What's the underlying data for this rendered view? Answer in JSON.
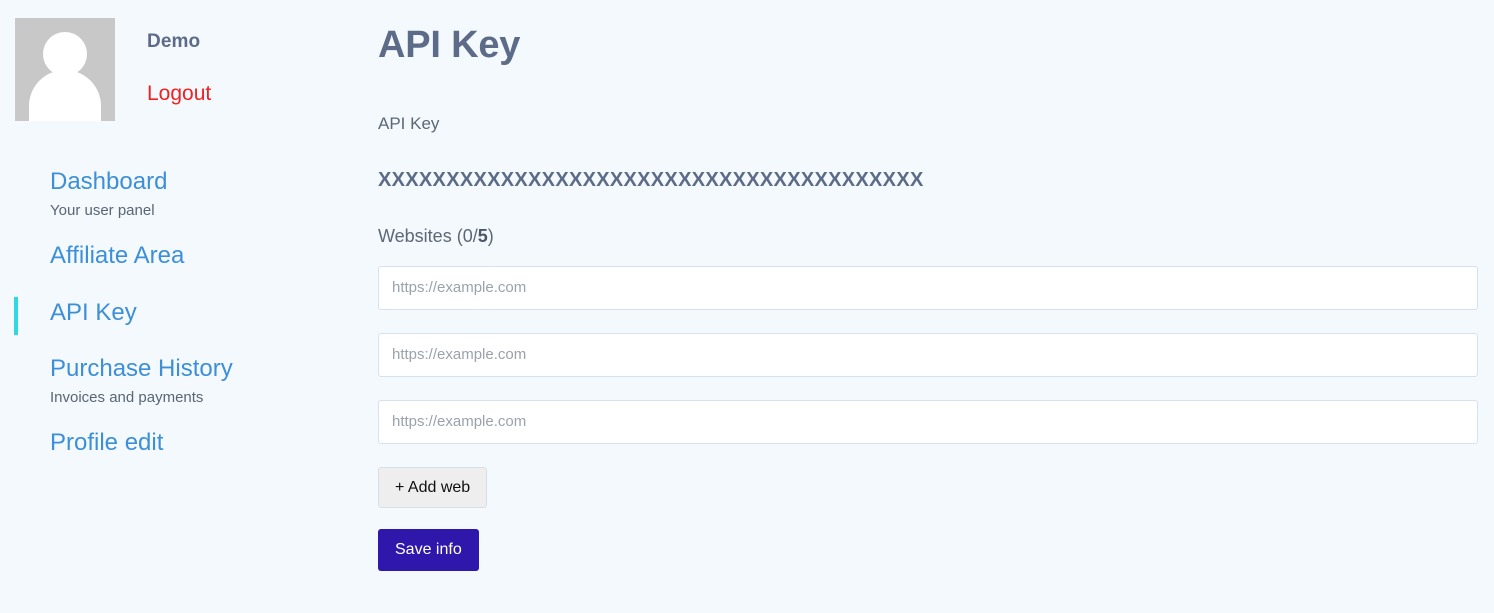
{
  "colors": {
    "background": "#f4f9fd",
    "link": "#3d8fd8",
    "heading": "#5c6b87",
    "logout": "#ee2222",
    "active_indicator": "#2fd9e3",
    "save_button": "#2e17aa",
    "add_button": "#eeeeee",
    "avatar": "#c8c8c8"
  },
  "sidebar": {
    "user": {
      "name": "Demo",
      "logout_label": "Logout",
      "avatar_icon": "user-avatar-icon"
    },
    "items": [
      {
        "label": "Dashboard",
        "sub": "Your user panel",
        "active": false
      },
      {
        "label": "Affiliate Area",
        "sub": "",
        "active": false
      },
      {
        "label": "API Key",
        "sub": "",
        "active": true
      },
      {
        "label": "Purchase History",
        "sub": "Invoices and payments",
        "active": false
      },
      {
        "label": "Profile edit",
        "sub": "",
        "active": false
      }
    ]
  },
  "main": {
    "title": "API Key",
    "api_key_label": "API Key",
    "api_key_value": "XXXXXXXXXXXXXXXXXXXXXXXXXXXXXXXXXXXXXXXX",
    "websites_label_prefix": "Websites (0/",
    "websites_limit": "5",
    "websites_label_suffix": ")",
    "websites_used": "0",
    "inputs": [
      {
        "value": "",
        "placeholder": "https://example.com"
      },
      {
        "value": "",
        "placeholder": "https://example.com"
      },
      {
        "value": "",
        "placeholder": "https://example.com"
      }
    ],
    "add_web_label": "+ Add web",
    "save_label": "Save info"
  }
}
